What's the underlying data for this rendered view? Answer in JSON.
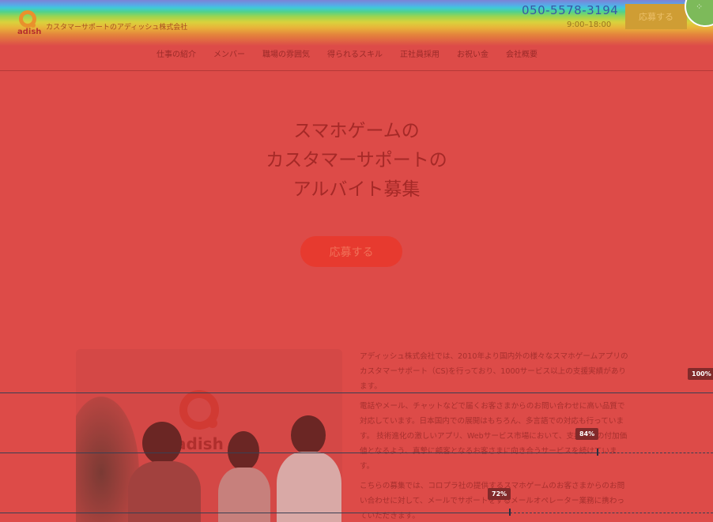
{
  "header": {
    "logo_text": "adish",
    "company_name": "カスタマーサポートのアディッシュ株式会社",
    "phone": "050-5578-3194",
    "hours": "9:00–18:00",
    "apply_label": "応募する"
  },
  "nav": {
    "items": [
      "仕事の紹介",
      "メンバー",
      "職場の雰囲気",
      "得られるスキル",
      "正社員採用",
      "お祝い金",
      "会社概要"
    ]
  },
  "hero": {
    "title_lines": [
      "スマホゲームの",
      "カスタマーサポートの",
      "アルバイト募集"
    ],
    "apply_label": "応募する"
  },
  "photo": {
    "logo_text": "adish"
  },
  "intro": {
    "paragraphs": [
      "アディッシュ株式会社では、2010年より国内外の様々なスマホゲームアプリのカスタマーサポート（CS)を行っており、1000サービス以上の支援実績があります。",
      "電話やメール、チャットなどで届くお客さまからのお問い合わせに高い品質で対応しています。日本国内での展開はもちろん、多言語での対応も行っています。 技術進化の激しいアプリ、Webサービス市場において、支援企業の付加価値となるよう、真摯に顧客となるお客さまに向き合うサービスを続けています。",
      "こちらの募集では、コロプラ社の提供するスマホゲームのお客さまからのお問い合わせに対して、メールでサポートをするメールオペレーター業務に携わっていただきます。"
    ]
  },
  "scroll_markers": [
    {
      "label": "100%"
    },
    {
      "label": "84%"
    },
    {
      "label": "72%"
    }
  ],
  "colors": {
    "overlay": "#dd4b48",
    "accent_orange": "#e9912c",
    "apply_button": "#e73a2f"
  }
}
